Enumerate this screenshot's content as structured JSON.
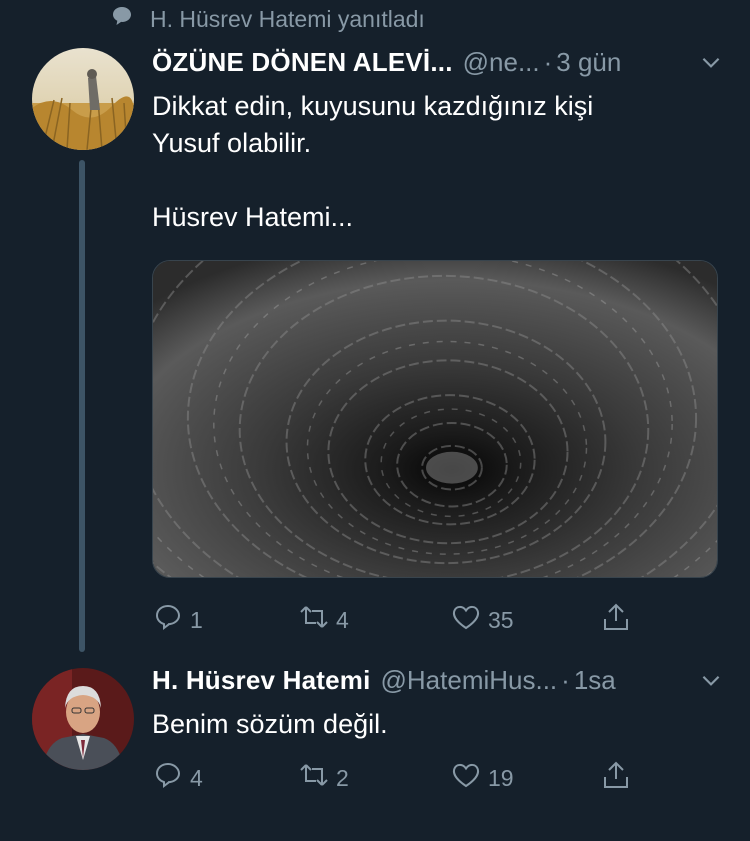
{
  "context": {
    "icon": "speech-bubble-icon",
    "text": "H. Hüsrev Hatemi yanıtladı"
  },
  "tweets": [
    {
      "name": "ÖZÜNE DÖNEN ALEVİ...",
      "handle": "@ne...",
      "separator": "·",
      "time": "3 gün",
      "lines": [
        "Dikkat edin, kuyusunu kazdığınız kişi",
        "Yusuf olabilir.",
        "Hüsrev Hatemi..."
      ],
      "media": "well-photo",
      "replies": "1",
      "retweets": "4",
      "likes": "35"
    },
    {
      "name": "H. Hüsrev Hatemi",
      "handle": "@HatemiHus...",
      "separator": "·",
      "time": "1sa",
      "lines": [
        "Benim sözüm değil."
      ],
      "replies": "4",
      "retweets": "2",
      "likes": "19"
    }
  ],
  "colors": {
    "background": "#15202b",
    "secondary_text": "#8899a6",
    "thread_line": "#3d5466"
  }
}
